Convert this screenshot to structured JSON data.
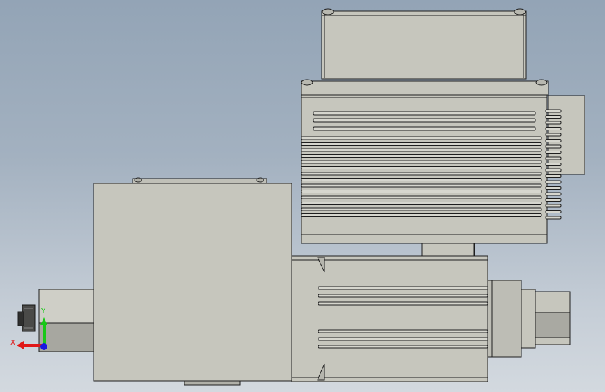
{
  "viewport": {
    "background_top": "#93a4b6",
    "background_bottom": "#d3d9df"
  },
  "model": {
    "body_color": "#c6c6bd",
    "edge_color": "#1e1e1e",
    "shadow_color": "#9a9a92"
  },
  "triad": {
    "x_label": "X",
    "y_label": "Y",
    "x_color": "#e01818",
    "y_color": "#18c818",
    "z_color": "#1818e0"
  }
}
